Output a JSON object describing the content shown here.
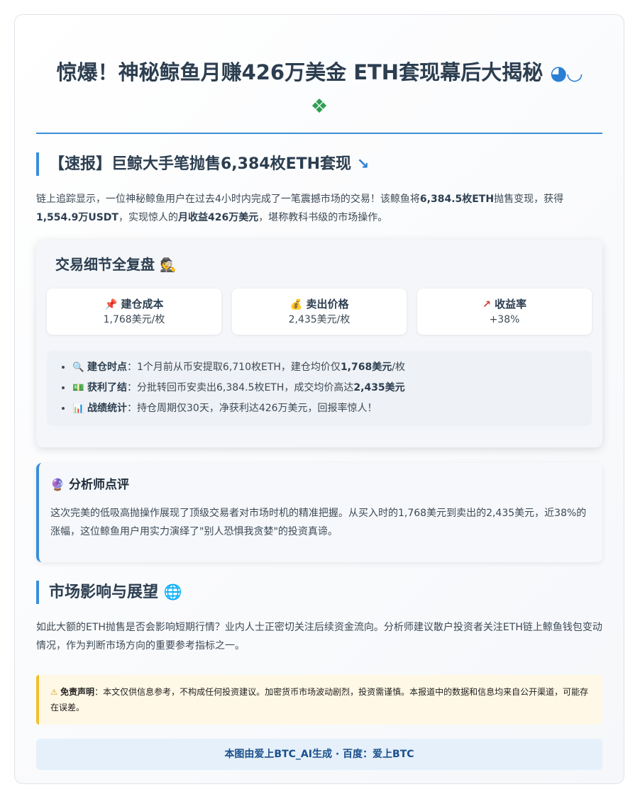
{
  "header": {
    "title": "惊爆！神秘鲸鱼月赚426万美金 ETH套现幕后大揭秘",
    "icons": [
      "whale-icon",
      "money-icon"
    ]
  },
  "flash": {
    "heading": "【速报】巨鲸大手笔抛售6,384枚ETH套现",
    "icon": "chart-down-icon",
    "p1": "链上追踪显示，一位神秘鲸鱼用户在过去4小时内完成了一笔震撼市场的交易！该鲸鱼将",
    "b1": "6,384.5枚ETH",
    "p2": "抛售变现，获得",
    "b2": "1,554.9万USDT",
    "p3": "，实现惊人的",
    "b3": "月收益426万美元",
    "p4": "，堪称教科书级的市场操作。"
  },
  "details": {
    "heading": "交易细节全复盘",
    "icon": "detective-icon",
    "stats": [
      {
        "icon": "pushpin-icon",
        "label": "建仓成本",
        "value": "1,768美元/枚"
      },
      {
        "icon": "money-bag-icon",
        "label": "卖出价格",
        "value": "2,435美元/枚"
      },
      {
        "icon": "chart-up-icon",
        "label": "收益率",
        "value": "+38%"
      }
    ],
    "items": [
      {
        "icon": "magnifier-icon",
        "title": "建仓时点",
        "text": "：1个月前从币安提取6,710枚ETH，建仓均价仅",
        "bold": "1,768美元",
        "tail": "/枚"
      },
      {
        "icon": "cash-icon",
        "title": "获利了结",
        "text": "：分批转回币安卖出6,384.5枚ETH，成交均价高达",
        "bold": "2,435美元",
        "tail": ""
      },
      {
        "icon": "bar-chart-icon",
        "title": "战绩统计",
        "text": "：持仓周期仅30天，净获利达426万美元，回报率惊人！",
        "bold": "",
        "tail": ""
      }
    ]
  },
  "analyst": {
    "heading": "分析师点评",
    "icon": "crystal-ball-icon",
    "text": "这次完美的低吸高抛操作展现了顶级交易者对市场时机的精准把握。从买入时的1,768美元到卖出的2,435美元，近38%的涨幅，这位鲸鱼用户用实力演绎了\"别人恐惧我贪婪\"的投资真谛。"
  },
  "market": {
    "heading": "市场影响与展望",
    "icon": "globe-icon",
    "text": "如此大额的ETH抛售是否会影响短期行情？业内人士正密切关注后续资金流向。分析师建议散户投资者关注ETH链上鲸鱼钱包变动情况，作为判断市场方向的重要参考指标之一。"
  },
  "disclaimer": {
    "icon": "warning-icon",
    "label": "免责声明",
    "text": "：本文仅供信息参考，不构成任何投资建议。加密货币市场波动剧烈，投资需谨慎。本报道中的数据和信息均来自公开渠道，可能存在误差。"
  },
  "footer": {
    "text": "本图由爱上BTC_AI生成 · 百度：爱上BTC"
  },
  "colors": {
    "accent": "#3a8fd8",
    "warning": "#f2c029",
    "footer_bg": "#e5f0fb",
    "footer_text": "#1a4f8b"
  }
}
